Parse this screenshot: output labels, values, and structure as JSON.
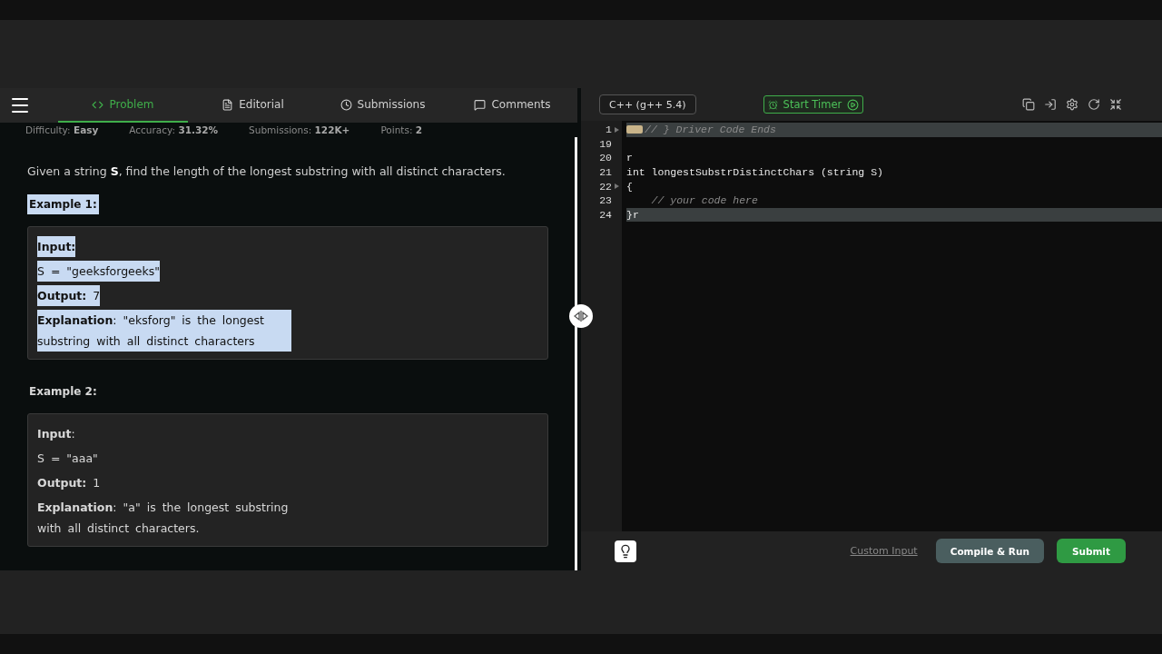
{
  "problem_tabs": [
    {
      "label": "Problem",
      "selected": true
    },
    {
      "label": "Editorial",
      "selected": false
    },
    {
      "label": "Submissions",
      "selected": false
    },
    {
      "label": "Comments",
      "selected": false
    }
  ],
  "meta": [
    "Difficulty: **Easy**",
    "Accuracy: **31.32%**",
    "Submissions: **122K+**",
    "Points: **2**"
  ],
  "statement": "Given a string **S**, find the length of the longest substring with all distinct characters.",
  "examples": [
    {
      "title": "Example 1:",
      "highlighted": true,
      "lines": [
        "**Input:**",
        "S = \"geeksforgeeks\"",
        "**Output:**  7",
        "**Explanation**: \"eksforg\" is the longest substring with all distinct characters"
      ]
    },
    {
      "title": "Example 2:",
      "highlighted": false,
      "lines": [
        "**Input**:",
        "S = \"aaa\"",
        "**Output:**  1",
        "**Explanation**: \"a\" is the longest substring with all distinct characters."
      ]
    }
  ],
  "editor_toolbar": {
    "language": "C++ (g++ 5.4)",
    "timer_button": "Start Timer"
  },
  "code_lines": [
    {
      "number": "1",
      "text": "// } Driver Code Ends",
      "kind": "comment",
      "folded": true,
      "fold_arrow": true,
      "highlighted": true
    },
    {
      "number": "19",
      "highlighted": false
    },
    {
      "number": "20",
      "text": "r",
      "kind": "code",
      "highlighted": false
    },
    {
      "number": "21",
      "text": "int longestSubstrDistinctChars (string S)",
      "kind": "code",
      "highlighted": false
    },
    {
      "number": "22",
      "text": "{",
      "kind": "code",
      "fold_arrow": true,
      "highlighted": false
    },
    {
      "number": "23",
      "text": "    // your code here",
      "kind": "comment",
      "highlighted": false
    },
    {
      "number": "24",
      "text": "}r",
      "kind": "code",
      "highlighted": true
    }
  ],
  "footer": {
    "custom_input": "Custom Input",
    "compile_button": "Compile & Run",
    "submit_button": "Submit"
  }
}
